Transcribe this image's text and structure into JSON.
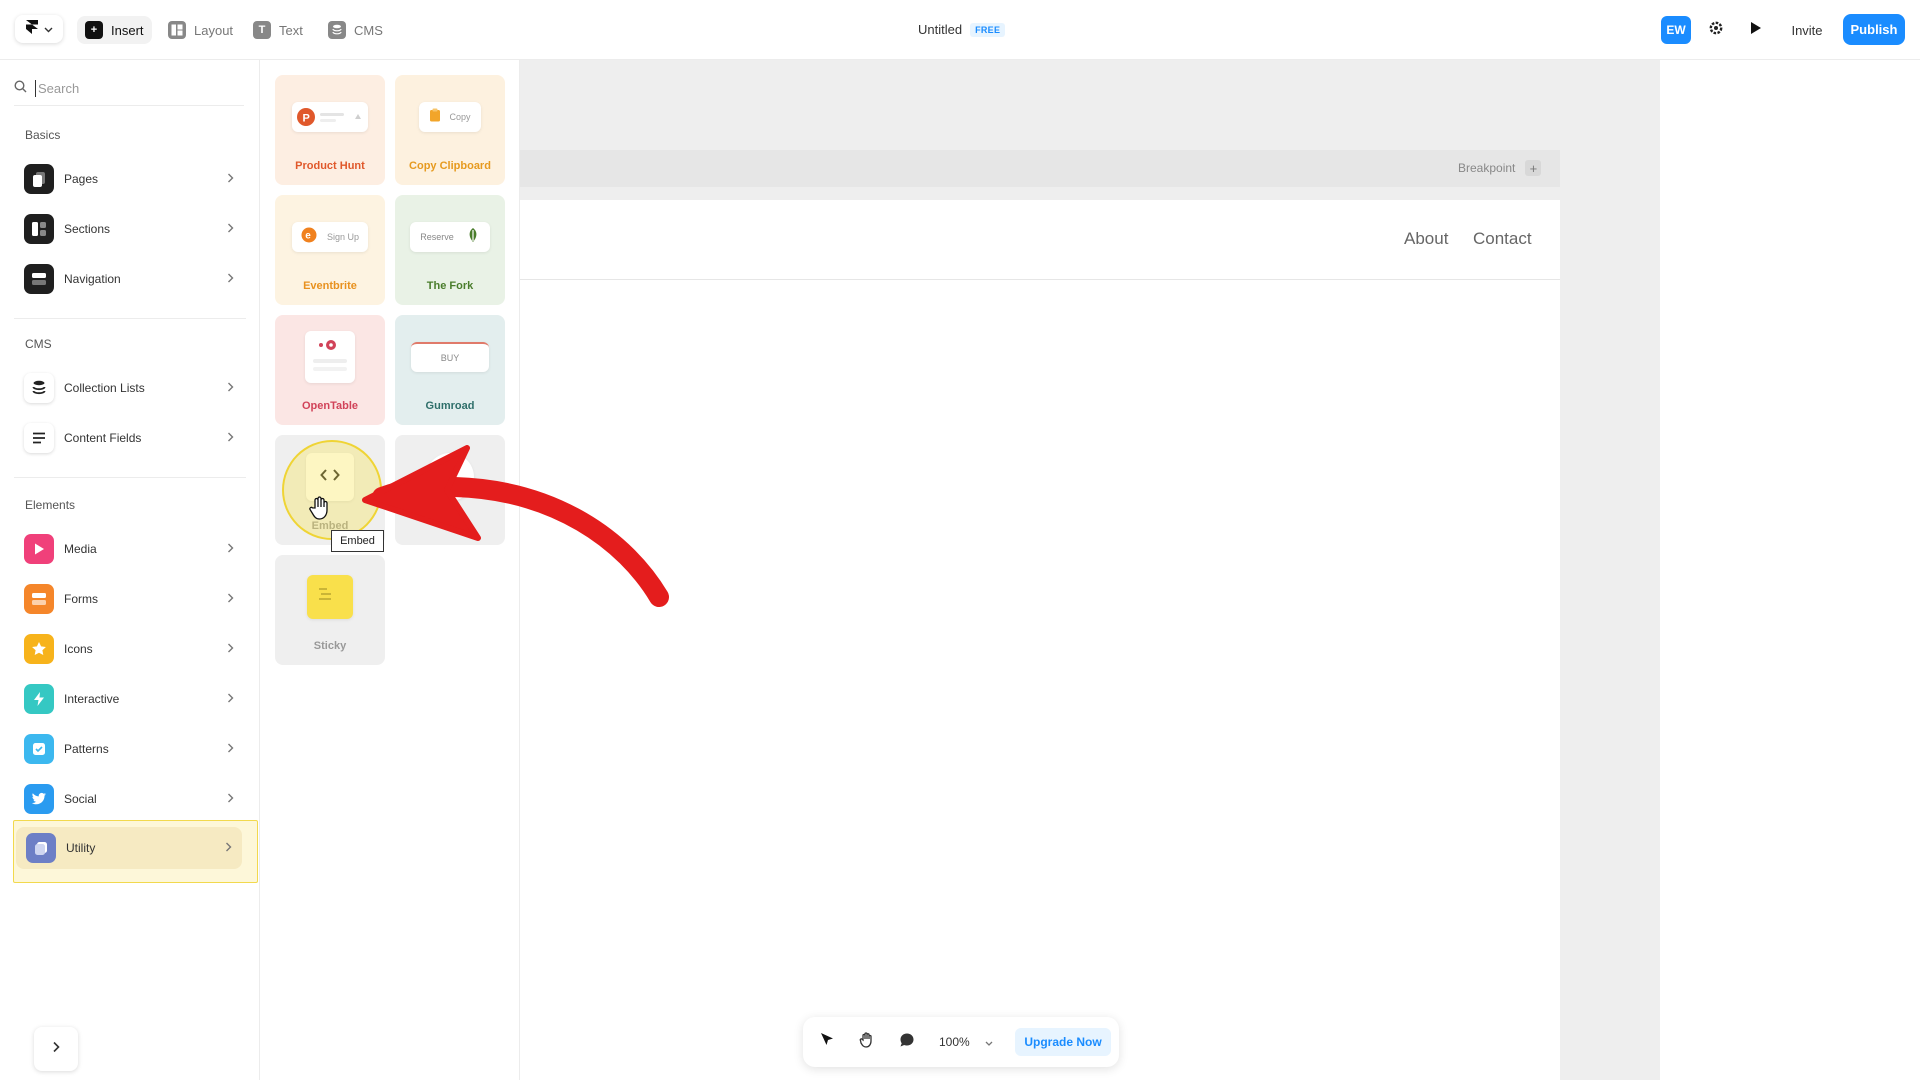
{
  "topbar": {
    "tabs": [
      {
        "label": "Insert",
        "icon": "plus-icon"
      },
      {
        "label": "Layout",
        "icon": "layout-icon"
      },
      {
        "label": "Text",
        "icon": "text-icon"
      },
      {
        "label": "CMS",
        "icon": "database-icon"
      }
    ],
    "doc_title": "Untitled",
    "plan_badge": "FREE",
    "avatar_initials": "EW",
    "invite_label": "Invite",
    "publish_label": "Publish"
  },
  "sidebar": {
    "search_placeholder": "Search",
    "sections": {
      "basics": "Basics",
      "cms": "CMS",
      "elements": "Elements"
    },
    "items": [
      {
        "label": "Pages",
        "icon": "pages-icon"
      },
      {
        "label": "Sections",
        "icon": "sections-icon"
      },
      {
        "label": "Navigation",
        "icon": "navigation-icon"
      },
      {
        "label": "Collection Lists",
        "icon": "collection-icon"
      },
      {
        "label": "Content Fields",
        "icon": "content-fields-icon"
      },
      {
        "label": "Media",
        "icon": "media-icon"
      },
      {
        "label": "Forms",
        "icon": "forms-icon"
      },
      {
        "label": "Icons",
        "icon": "star-icon"
      },
      {
        "label": "Interactive",
        "icon": "bolt-icon"
      },
      {
        "label": "Patterns",
        "icon": "checkbox-icon"
      },
      {
        "label": "Social",
        "icon": "twitter-icon"
      },
      {
        "label": "Utility",
        "icon": "utility-icon",
        "selected": true
      }
    ]
  },
  "panel": {
    "cards": [
      {
        "label": "Product Hunt",
        "inner_text": "",
        "color": "#e0582b",
        "bg": "#fdeee2"
      },
      {
        "label": "Copy Clipboard",
        "inner_text": "Copy",
        "color": "#e69a1f",
        "bg": "#fdf1df"
      },
      {
        "label": "Eventbrite",
        "inner_text": "Sign Up",
        "color": "#e8911f",
        "bg": "#fdf3e1"
      },
      {
        "label": "The Fork",
        "inner_text": "Reserve",
        "color": "#4a7d2c",
        "bg": "#e9f2e6"
      },
      {
        "label": "OpenTable",
        "inner_text": "",
        "color": "#d14359",
        "bg": "#fbe6e4"
      },
      {
        "label": "Gumroad",
        "inner_text": "BUY",
        "color": "#2f6f6a",
        "bg": "#e3eeee"
      },
      {
        "label": "Embed",
        "inner_text": "",
        "color": "#888888",
        "bg": "#efefef"
      },
      {
        "label": "",
        "inner_text": "",
        "color": "#888888",
        "bg": "#efefef"
      },
      {
        "label": "Sticky",
        "inner_text": "",
        "color": "#888888",
        "bg": "#efefef"
      }
    ],
    "tooltip": "Embed"
  },
  "canvas": {
    "breakpoint_label": "Breakpoint",
    "nav_links": [
      "About",
      "Contact"
    ]
  },
  "toolbar": {
    "zoom": "100%",
    "upgrade_label": "Upgrade Now"
  }
}
